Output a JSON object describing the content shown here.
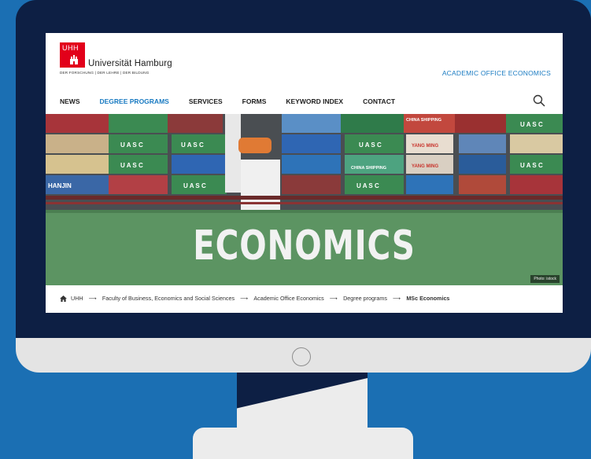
{
  "header": {
    "logo_text": "UHH",
    "university_name": "Universität Hamburg",
    "tagline": "DER FORSCHUNG | DER LEHRE | DER BILDUNG",
    "office_link": "ACADEMIC OFFICE ECONOMICS"
  },
  "nav": {
    "items": [
      {
        "label": "NEWS"
      },
      {
        "label": "DEGREE PROGRAMS"
      },
      {
        "label": "SERVICES"
      },
      {
        "label": "FORMS"
      },
      {
        "label": "KEYWORD INDEX"
      },
      {
        "label": "CONTACT"
      }
    ],
    "active_index": 1
  },
  "hero": {
    "title": "ECONOMICS",
    "photo_credit": "Photo: istock",
    "container_texts": [
      "U A S C",
      "CHINA SHIPPING",
      "YANG MING",
      "HANJIN"
    ]
  },
  "breadcrumb": {
    "items": [
      "UHH",
      "Faculty of Business, Economics and Social Sciences",
      "Academic Office Economics",
      "Degree programs",
      "MSc Economics"
    ],
    "separator": "⟶"
  },
  "colors": {
    "background": "#1b6fb3",
    "bezel": "#0d1f44",
    "brand_red": "#e2001a",
    "link_blue": "#1a7bc2",
    "hull_green": "#5c9462"
  }
}
